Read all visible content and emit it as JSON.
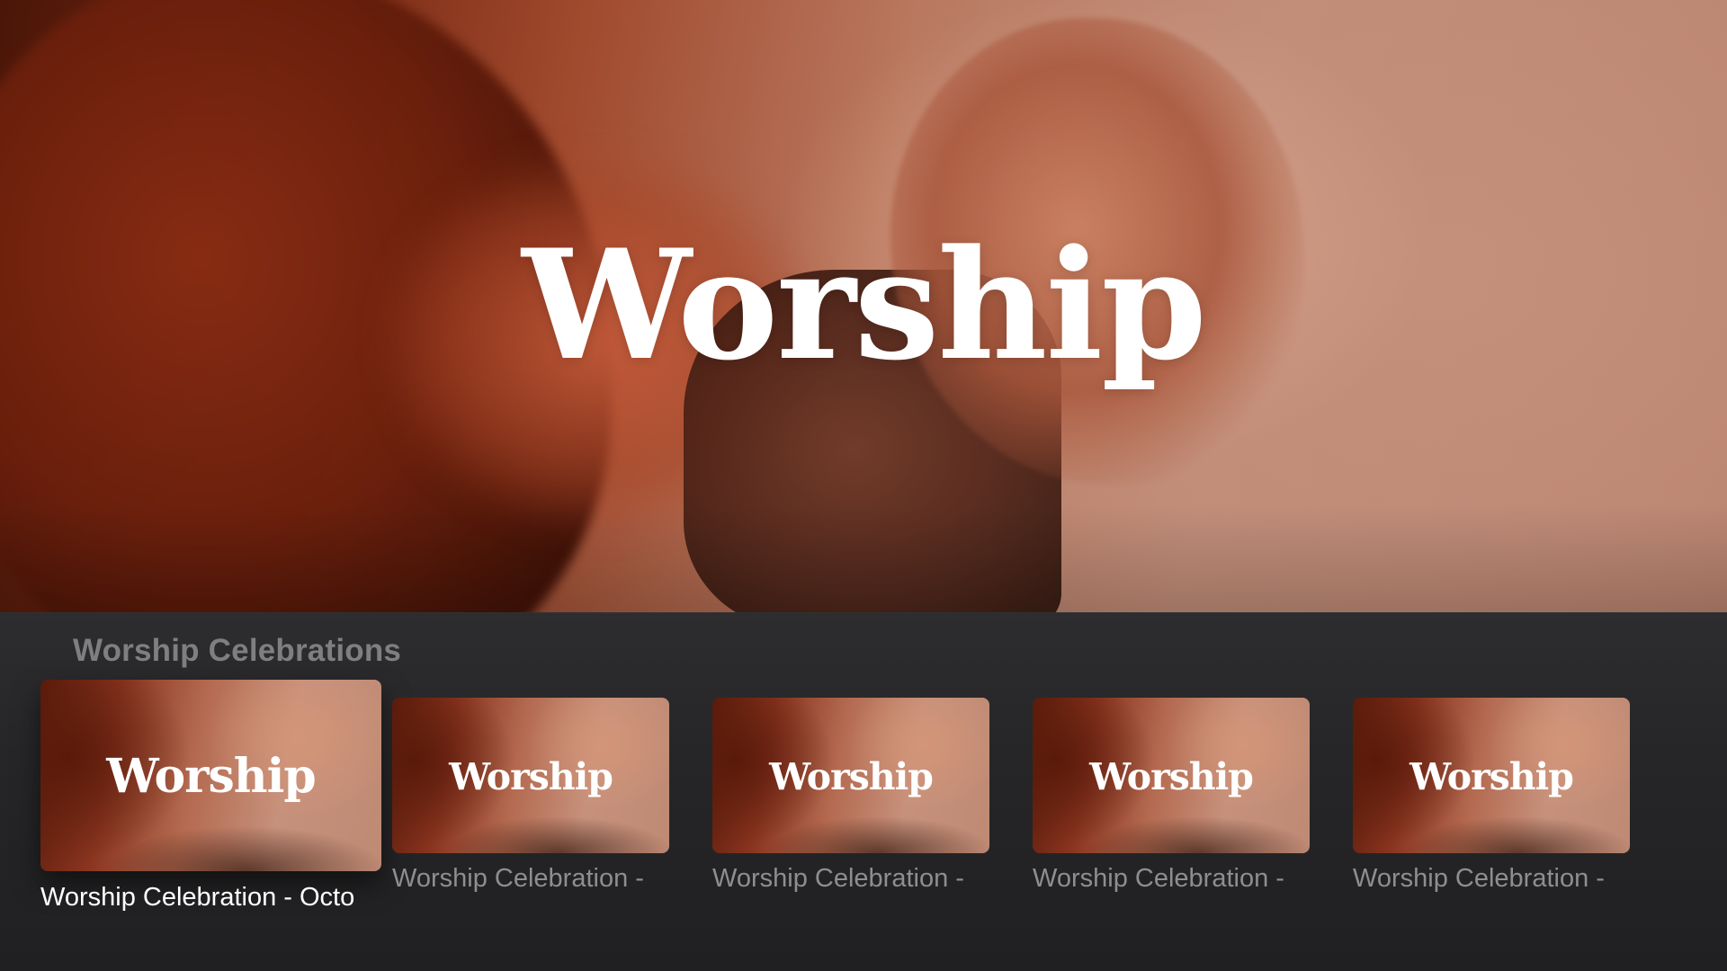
{
  "hero": {
    "title": "Worship"
  },
  "shelf": {
    "title": "Worship Celebrations",
    "items": [
      {
        "thumb_title": "Worship",
        "label": "Worship Celebration - Octo",
        "focused": true
      },
      {
        "thumb_title": "Worship",
        "label": "Worship Celebration -",
        "focused": false
      },
      {
        "thumb_title": "Worship",
        "label": "Worship Celebration -",
        "focused": false
      },
      {
        "thumb_title": "Worship",
        "label": "Worship Celebration -",
        "focused": false
      },
      {
        "thumb_title": "Worship",
        "label": "Worship Celebration -",
        "focused": false
      }
    ]
  }
}
